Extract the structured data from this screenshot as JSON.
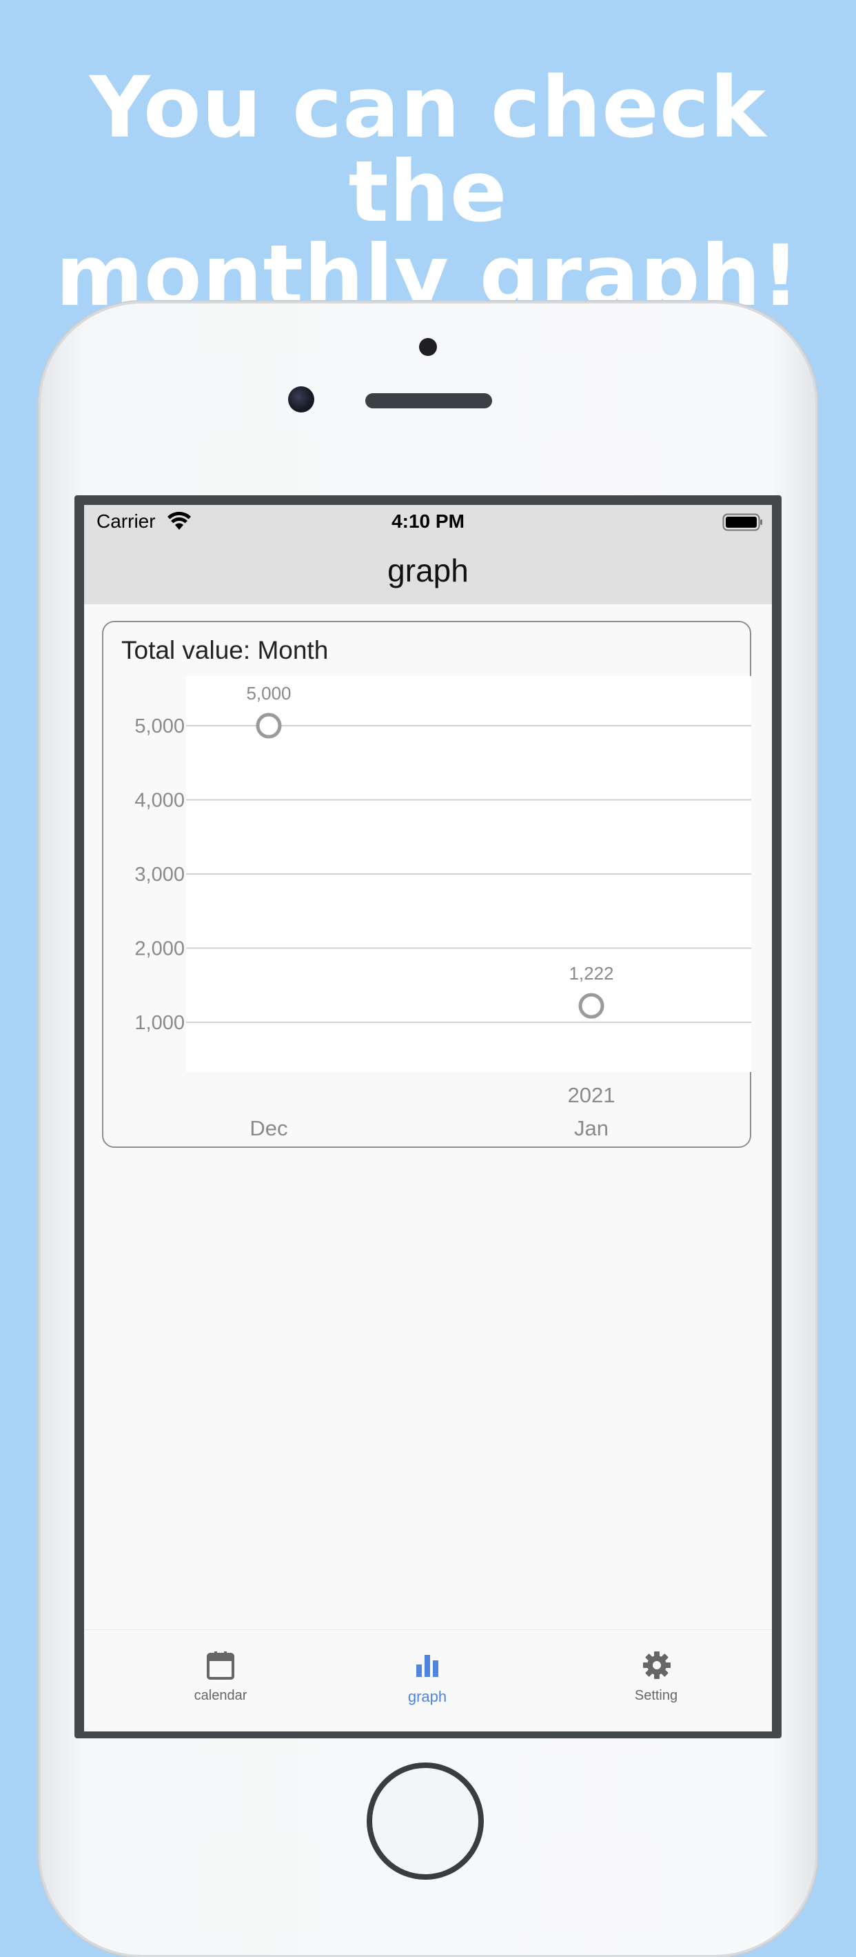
{
  "headline": {
    "line1": "You can check the",
    "line2": "monthly graph!"
  },
  "status_bar": {
    "carrier": "Carrier",
    "time": "4:10 PM"
  },
  "nav": {
    "title": "graph"
  },
  "card": {
    "title": "Total value: Month"
  },
  "chart_data": {
    "type": "scatter",
    "title": "Total value: Month",
    "categories": [
      "Dec",
      "Jan"
    ],
    "x_sublabels": [
      "",
      "2021"
    ],
    "series": [
      {
        "values": [
          5000,
          1222
        ]
      }
    ],
    "data_labels": [
      "5,000",
      "1,222"
    ],
    "y_ticks": [
      1000,
      2000,
      3000,
      4000,
      5000
    ],
    "y_tick_labels": [
      "1,000",
      "2,000",
      "3,000",
      "4,000",
      "5,000"
    ],
    "ylim": [
      330,
      5670
    ],
    "grid": true,
    "marker": "hollow-circle",
    "marker_color": "#9a9a9a"
  },
  "tabs": [
    {
      "label": "calendar",
      "icon": "calendar-icon",
      "active": false
    },
    {
      "label": "graph",
      "icon": "bar-chart-icon",
      "active": true
    },
    {
      "label": "Setting",
      "icon": "gear-icon",
      "active": false
    }
  ],
  "colors": {
    "background": "#a8d3f7",
    "accent": "#4f85e0",
    "appbar": "#e0e0e0"
  }
}
